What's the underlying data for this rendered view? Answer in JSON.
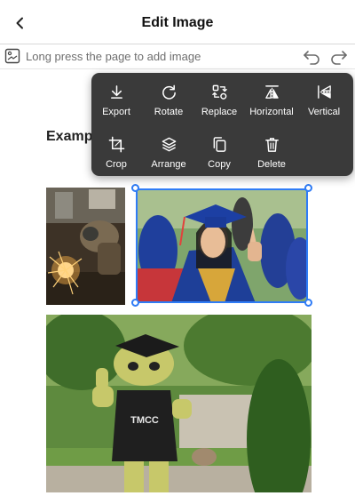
{
  "header": {
    "title": "Edit Image"
  },
  "hint_bar": {
    "text": "Long press the page to add image"
  },
  "document": {
    "heading": "Example Images with Alt Text in TMCC",
    "images": [
      {
        "icon": "welder-photo",
        "subject": "Welder with sparks"
      },
      {
        "icon": "graduate-photo",
        "subject": "Smiling graduate in cap and gown",
        "selected": true
      },
      {
        "icon": "mascot-photo",
        "subject": "Mascot in TMCC shirt giving thumbs up",
        "shirt_text": "TMCC"
      }
    ]
  },
  "toolbar": {
    "tools": [
      {
        "label": "Export",
        "icon": "export-icon"
      },
      {
        "label": "Rotate",
        "icon": "rotate-icon"
      },
      {
        "label": "Replace",
        "icon": "replace-icon"
      },
      {
        "label": "Horizontal",
        "icon": "flip-horizontal-icon"
      },
      {
        "label": "Vertical",
        "icon": "flip-vertical-icon"
      },
      {
        "label": "Crop",
        "icon": "crop-icon"
      },
      {
        "label": "Arrange",
        "icon": "arrange-icon"
      },
      {
        "label": "Copy",
        "icon": "copy-icon"
      },
      {
        "label": "Delete",
        "icon": "delete-icon"
      }
    ]
  },
  "colors": {
    "selection": "#2f7cf6",
    "toolbar_bg": "#3a3a3a"
  }
}
